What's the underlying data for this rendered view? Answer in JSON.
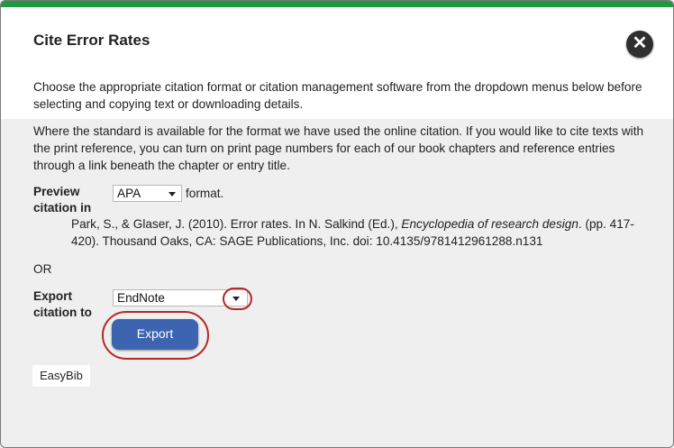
{
  "dialog": {
    "title": "Cite Error Rates",
    "close_glyph": "✕"
  },
  "intro_text": "Choose the appropriate citation format or citation management software from the dropdown menus below before selecting and copying text or downloading details.",
  "info_text": "Where the standard is available for the format we have used the online citation. If you would like to cite texts with the print reference, you can turn on print page numbers for each of our book chapters and reference entries through a link beneath the chapter or entry title.",
  "preview": {
    "label": "Preview citation in",
    "format_selected": "APA",
    "format_suffix": "format."
  },
  "citation": {
    "before_title": "Park, S., & Glaser, J. (2010). Error rates. In N. Salkind (Ed.), ",
    "book_title": "Encyclopedia of research design",
    "after_title": ". (pp. 417-420). Thousand Oaks, CA: SAGE Publications, Inc. doi: 10.4135/9781412961288.n131"
  },
  "or_text": "OR",
  "export": {
    "label": "Export citation to",
    "selected": "EndNote",
    "button_label": "Export"
  },
  "easybib_label": "EasyBib",
  "colors": {
    "top_bar": "#1b9a3f",
    "export_button": "#3c64b1",
    "highlight_ring": "#b52828",
    "close_button": "#2f2f2f"
  }
}
